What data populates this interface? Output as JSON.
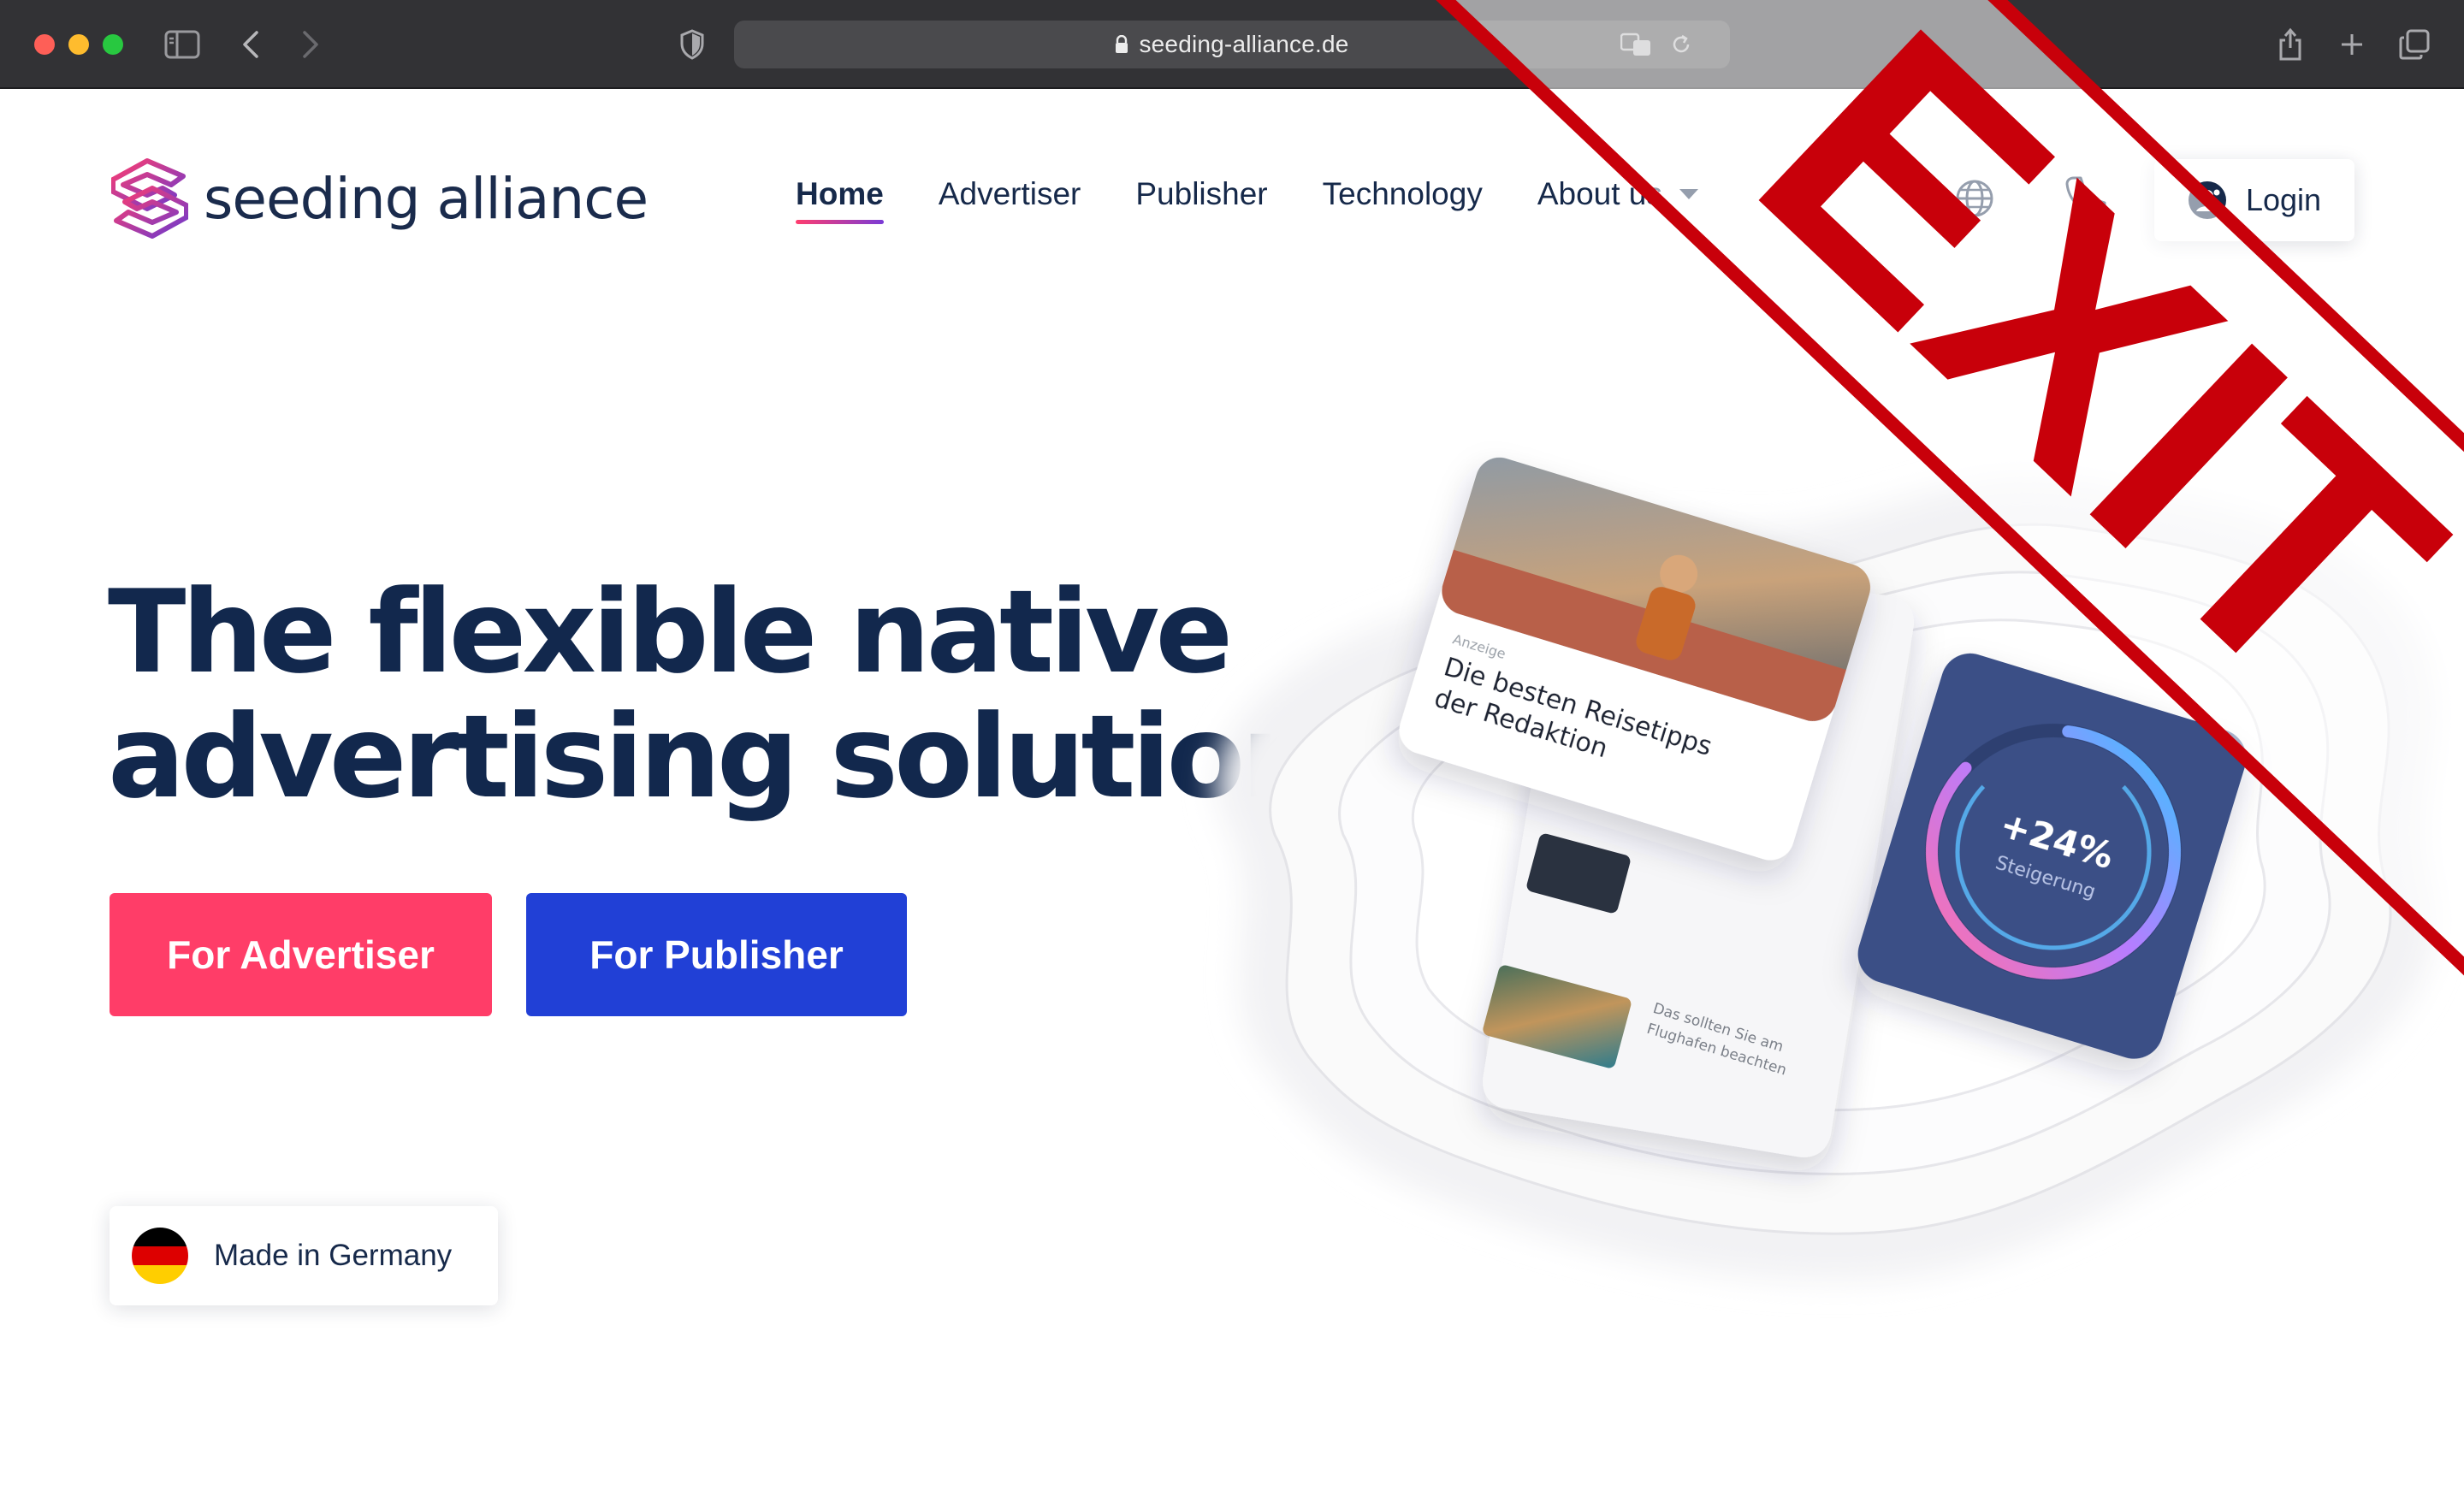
{
  "browser": {
    "url": "seeding-alliance.de"
  },
  "header": {
    "logo_text": "seeding alliance",
    "nav": [
      {
        "label": "Home",
        "active": true
      },
      {
        "label": "Advertiser"
      },
      {
        "label": "Publisher"
      },
      {
        "label": "Technology"
      },
      {
        "label": "About us",
        "dropdown": true
      }
    ],
    "login_label": "Login"
  },
  "hero": {
    "headline_line1": "The flexible native",
    "headline_line2": "advertising solution",
    "cta_advertiser": "For Advertiser",
    "cta_publisher": "For Publisher",
    "badge": "Made in Germany"
  },
  "illustration": {
    "ad_label": "Anzeige",
    "ad_headline_line1": "Die besten Reisetipps",
    "ad_headline_line2": "der Redaktion",
    "stat_value": "+24%",
    "stat_label": "Steigerung",
    "list_item_text_line1": "Das sollten Sie am",
    "list_item_text_line2": "Flughafen beachten"
  },
  "overlay": {
    "stamp_text": "EXIT",
    "color": "#c8000a"
  },
  "colors": {
    "navy": "#12284d",
    "advertiser_button": "#ff3d68",
    "publisher_button": "#2140d6",
    "chrome_bg": "#323235"
  }
}
